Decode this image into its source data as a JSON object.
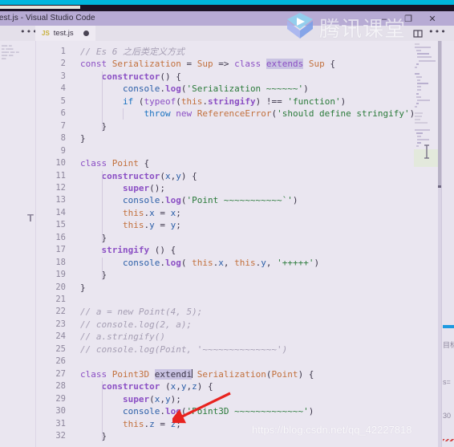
{
  "window": {
    "title": "test.js - Visual Studio Code",
    "controls": [
      {
        "name": "minimize",
        "glyph": "–"
      },
      {
        "name": "maximize",
        "glyph": "❐"
      },
      {
        "name": "close",
        "glyph": "✕"
      }
    ]
  },
  "tabbar": {
    "overflow_glyph": "•••",
    "tab": {
      "icon_label": "JS",
      "label": "test.js",
      "dirty": true
    },
    "split_editor_label": "",
    "more_actions_glyph": "•••"
  },
  "editor": {
    "language": "javascript",
    "letter_glyph": "T",
    "selection_text": "extendi",
    "lines": [
      {
        "n": 1,
        "text": "// Es 6 之后类定义方式"
      },
      {
        "n": 2,
        "text": "const Serialization = Sup => class extends Sup {"
      },
      {
        "n": 3,
        "text": "    constructor() {"
      },
      {
        "n": 4,
        "text": "        console.log('Serialization ~~~~~~')"
      },
      {
        "n": 5,
        "text": "        if (typeof(this.stringify) !== 'function')"
      },
      {
        "n": 6,
        "text": "            throw new ReferenceError('should define stringify')"
      },
      {
        "n": 7,
        "text": "    }"
      },
      {
        "n": 8,
        "text": "}"
      },
      {
        "n": 9,
        "text": ""
      },
      {
        "n": 10,
        "text": "class Point {"
      },
      {
        "n": 11,
        "text": "    constructor(x,y) {"
      },
      {
        "n": 12,
        "text": "        super();"
      },
      {
        "n": 13,
        "text": "        console.log('Point ~~~~~~~~~~~`')"
      },
      {
        "n": 14,
        "text": "        this.x = x;"
      },
      {
        "n": 15,
        "text": "        this.y = y;"
      },
      {
        "n": 16,
        "text": "    }"
      },
      {
        "n": 17,
        "text": "    stringify () {"
      },
      {
        "n": 18,
        "text": "        console.log( this.x, this.y, '+++++')"
      },
      {
        "n": 19,
        "text": "    }"
      },
      {
        "n": 20,
        "text": "}"
      },
      {
        "n": 21,
        "text": ""
      },
      {
        "n": 22,
        "text": "// a = new Point(4, 5);"
      },
      {
        "n": 23,
        "text": "// console.log(2, a);"
      },
      {
        "n": 24,
        "text": "// a.stringify()"
      },
      {
        "n": 25,
        "text": "// console.log(Point, '~~~~~~~~~~~~~~')"
      },
      {
        "n": 26,
        "text": ""
      },
      {
        "n": 27,
        "text": "class Point3D extendi Serialization(Point) {"
      },
      {
        "n": 28,
        "text": "    constructor (x,y,z) {"
      },
      {
        "n": 29,
        "text": "        super(x,y);"
      },
      {
        "n": 30,
        "text": "        console.log('Point3D ~~~~~~~~~~~~~')"
      },
      {
        "n": 31,
        "text": "        this.z = z;"
      },
      {
        "n": 32,
        "text": "    }"
      }
    ]
  },
  "right_panel": {
    "lines": [
      "目标",
      "s=",
      "30"
    ]
  },
  "watermarks": {
    "brand_cn": "腾讯课堂",
    "url": "https://blog.csdn.net/qq_42227818"
  },
  "colors": {
    "accent_cyan": "#00b6dd",
    "titlebar": "#b7abd4",
    "editor_bg": "#eae6f0",
    "keyword": "#8b4fc4",
    "string": "#2a7a3a",
    "comment": "#a59eb3",
    "class_name": "#c2703c",
    "variable": "#2b5fa8",
    "selection": "#c9c3e2"
  }
}
